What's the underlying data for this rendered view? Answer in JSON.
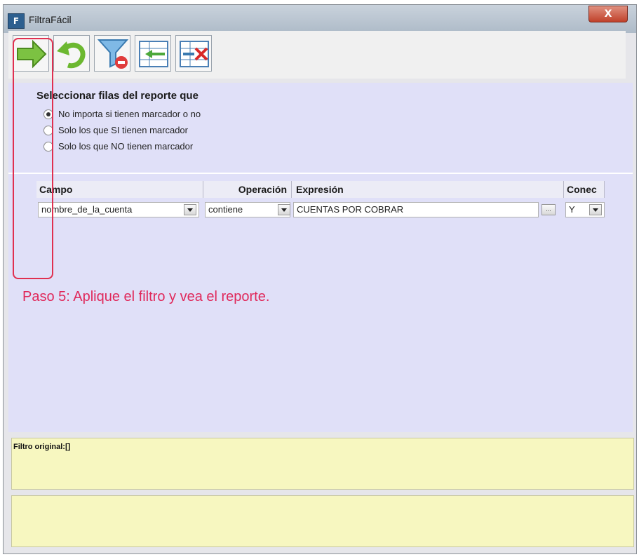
{
  "window": {
    "title": "FiltraFácil",
    "close_label": "X"
  },
  "toolbar": {
    "buttons": [
      {
        "name": "apply-filter",
        "icon": "green-arrow-right-icon"
      },
      {
        "name": "undo",
        "icon": "undo-arrow-icon"
      },
      {
        "name": "clear-filter",
        "icon": "funnel-remove-icon"
      },
      {
        "name": "insert-row",
        "icon": "table-insert-row-icon"
      },
      {
        "name": "delete-row",
        "icon": "table-delete-row-icon"
      }
    ]
  },
  "selection": {
    "heading": "Seleccionar filas del reporte que",
    "options": [
      {
        "label": "No importa si tienen marcador o no",
        "selected": true
      },
      {
        "label": "Solo los que SI tienen marcador",
        "selected": false
      },
      {
        "label": "Solo los que NO tienen marcador",
        "selected": false
      }
    ]
  },
  "grid": {
    "headers": {
      "campo": "Campo",
      "operacion": "Operación",
      "expresion": "Expresión",
      "conector": "Conec"
    },
    "row": {
      "campo": "nombre_de_la_cuenta",
      "operacion": "contiene",
      "expresion": "CUENTAS POR COBRAR",
      "ellipsis": "...",
      "conector": "Y"
    }
  },
  "annotation": {
    "text": "Paso 5: Aplique el filtro y vea el reporte."
  },
  "footer": {
    "filtro_original": "Filtro original:[]",
    "second_panel": ""
  },
  "colors": {
    "panel_bg": "#e0e0f8",
    "footer_bg": "#f7f7c0",
    "annotation": "#e03050"
  }
}
